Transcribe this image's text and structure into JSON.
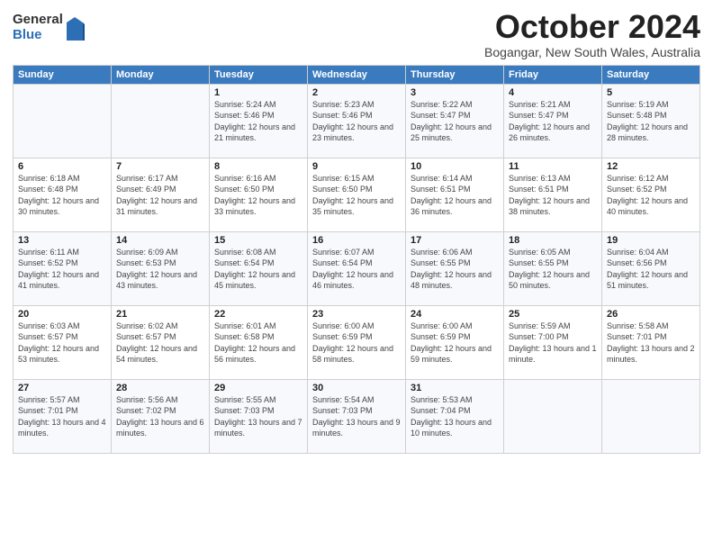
{
  "logo": {
    "general": "General",
    "blue": "Blue"
  },
  "header": {
    "month": "October 2024",
    "location": "Bogangar, New South Wales, Australia"
  },
  "weekdays": [
    "Sunday",
    "Monday",
    "Tuesday",
    "Wednesday",
    "Thursday",
    "Friday",
    "Saturday"
  ],
  "weeks": [
    [
      {
        "day": "",
        "info": ""
      },
      {
        "day": "",
        "info": ""
      },
      {
        "day": "1",
        "info": "Sunrise: 5:24 AM\nSunset: 5:46 PM\nDaylight: 12 hours and 21 minutes."
      },
      {
        "day": "2",
        "info": "Sunrise: 5:23 AM\nSunset: 5:46 PM\nDaylight: 12 hours and 23 minutes."
      },
      {
        "day": "3",
        "info": "Sunrise: 5:22 AM\nSunset: 5:47 PM\nDaylight: 12 hours and 25 minutes."
      },
      {
        "day": "4",
        "info": "Sunrise: 5:21 AM\nSunset: 5:47 PM\nDaylight: 12 hours and 26 minutes."
      },
      {
        "day": "5",
        "info": "Sunrise: 5:19 AM\nSunset: 5:48 PM\nDaylight: 12 hours and 28 minutes."
      }
    ],
    [
      {
        "day": "6",
        "info": "Sunrise: 6:18 AM\nSunset: 6:48 PM\nDaylight: 12 hours and 30 minutes."
      },
      {
        "day": "7",
        "info": "Sunrise: 6:17 AM\nSunset: 6:49 PM\nDaylight: 12 hours and 31 minutes."
      },
      {
        "day": "8",
        "info": "Sunrise: 6:16 AM\nSunset: 6:50 PM\nDaylight: 12 hours and 33 minutes."
      },
      {
        "day": "9",
        "info": "Sunrise: 6:15 AM\nSunset: 6:50 PM\nDaylight: 12 hours and 35 minutes."
      },
      {
        "day": "10",
        "info": "Sunrise: 6:14 AM\nSunset: 6:51 PM\nDaylight: 12 hours and 36 minutes."
      },
      {
        "day": "11",
        "info": "Sunrise: 6:13 AM\nSunset: 6:51 PM\nDaylight: 12 hours and 38 minutes."
      },
      {
        "day": "12",
        "info": "Sunrise: 6:12 AM\nSunset: 6:52 PM\nDaylight: 12 hours and 40 minutes."
      }
    ],
    [
      {
        "day": "13",
        "info": "Sunrise: 6:11 AM\nSunset: 6:52 PM\nDaylight: 12 hours and 41 minutes."
      },
      {
        "day": "14",
        "info": "Sunrise: 6:09 AM\nSunset: 6:53 PM\nDaylight: 12 hours and 43 minutes."
      },
      {
        "day": "15",
        "info": "Sunrise: 6:08 AM\nSunset: 6:54 PM\nDaylight: 12 hours and 45 minutes."
      },
      {
        "day": "16",
        "info": "Sunrise: 6:07 AM\nSunset: 6:54 PM\nDaylight: 12 hours and 46 minutes."
      },
      {
        "day": "17",
        "info": "Sunrise: 6:06 AM\nSunset: 6:55 PM\nDaylight: 12 hours and 48 minutes."
      },
      {
        "day": "18",
        "info": "Sunrise: 6:05 AM\nSunset: 6:55 PM\nDaylight: 12 hours and 50 minutes."
      },
      {
        "day": "19",
        "info": "Sunrise: 6:04 AM\nSunset: 6:56 PM\nDaylight: 12 hours and 51 minutes."
      }
    ],
    [
      {
        "day": "20",
        "info": "Sunrise: 6:03 AM\nSunset: 6:57 PM\nDaylight: 12 hours and 53 minutes."
      },
      {
        "day": "21",
        "info": "Sunrise: 6:02 AM\nSunset: 6:57 PM\nDaylight: 12 hours and 54 minutes."
      },
      {
        "day": "22",
        "info": "Sunrise: 6:01 AM\nSunset: 6:58 PM\nDaylight: 12 hours and 56 minutes."
      },
      {
        "day": "23",
        "info": "Sunrise: 6:00 AM\nSunset: 6:59 PM\nDaylight: 12 hours and 58 minutes."
      },
      {
        "day": "24",
        "info": "Sunrise: 6:00 AM\nSunset: 6:59 PM\nDaylight: 12 hours and 59 minutes."
      },
      {
        "day": "25",
        "info": "Sunrise: 5:59 AM\nSunset: 7:00 PM\nDaylight: 13 hours and 1 minute."
      },
      {
        "day": "26",
        "info": "Sunrise: 5:58 AM\nSunset: 7:01 PM\nDaylight: 13 hours and 2 minutes."
      }
    ],
    [
      {
        "day": "27",
        "info": "Sunrise: 5:57 AM\nSunset: 7:01 PM\nDaylight: 13 hours and 4 minutes."
      },
      {
        "day": "28",
        "info": "Sunrise: 5:56 AM\nSunset: 7:02 PM\nDaylight: 13 hours and 6 minutes."
      },
      {
        "day": "29",
        "info": "Sunrise: 5:55 AM\nSunset: 7:03 PM\nDaylight: 13 hours and 7 minutes."
      },
      {
        "day": "30",
        "info": "Sunrise: 5:54 AM\nSunset: 7:03 PM\nDaylight: 13 hours and 9 minutes."
      },
      {
        "day": "31",
        "info": "Sunrise: 5:53 AM\nSunset: 7:04 PM\nDaylight: 13 hours and 10 minutes."
      },
      {
        "day": "",
        "info": ""
      },
      {
        "day": "",
        "info": ""
      }
    ]
  ]
}
